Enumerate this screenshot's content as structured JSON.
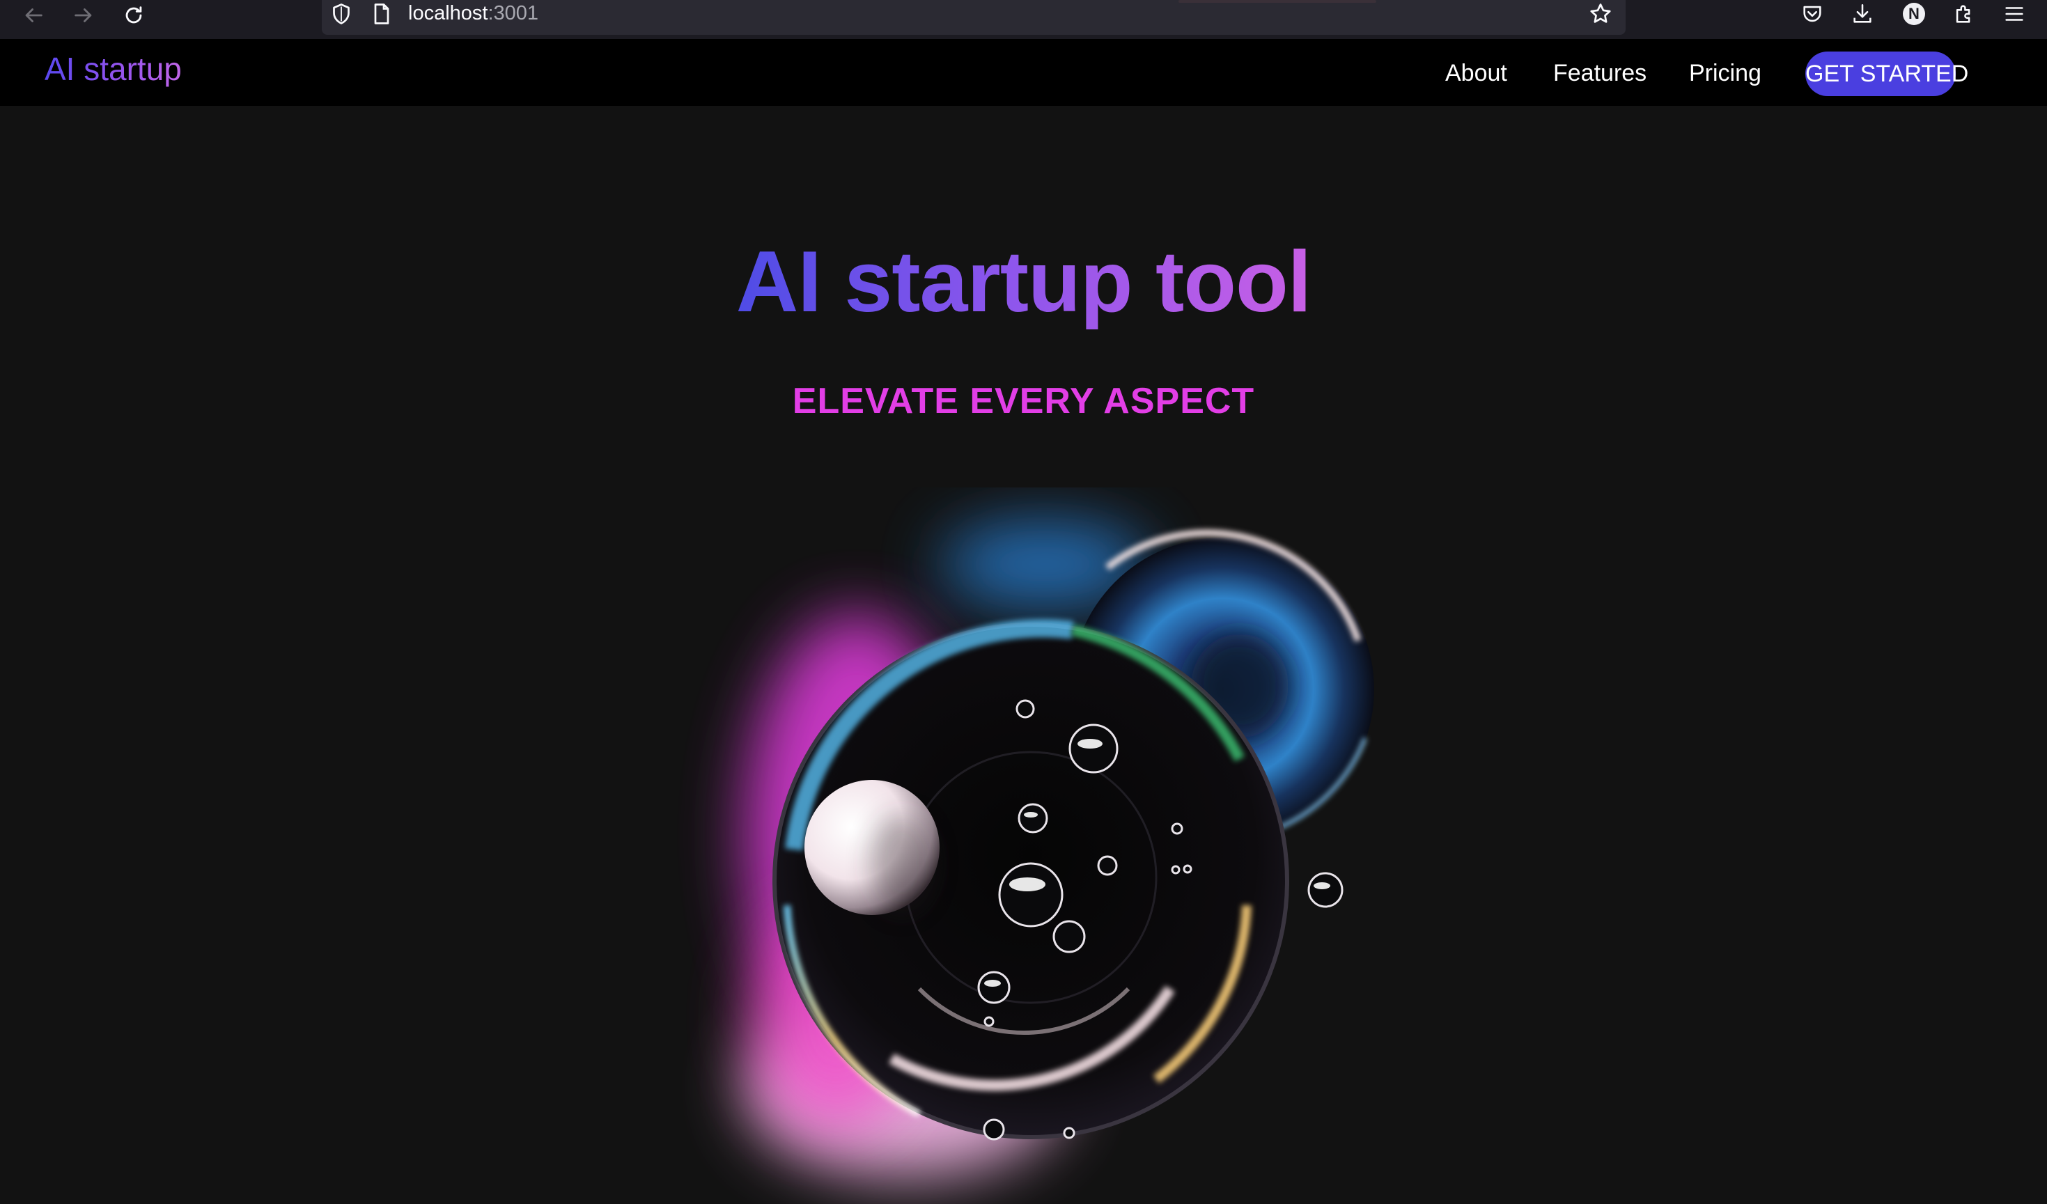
{
  "browser": {
    "url_host": "localhost",
    "url_port": ":3001",
    "profile_initial": "N",
    "icons": {
      "back": "arrow-left-icon",
      "forward": "arrow-right-icon",
      "reload": "reload-icon",
      "shield": "shield-icon",
      "page": "page-icon",
      "bookmark": "star-icon",
      "pocket": "pocket-icon",
      "downloads": "download-icon",
      "extensions": "puzzle-icon",
      "menu": "hamburger-menu-icon"
    }
  },
  "header": {
    "logo": "AI startup",
    "nav": [
      {
        "label": "About"
      },
      {
        "label": "Features"
      },
      {
        "label": "Pricing"
      }
    ],
    "cta": "GET STARTED"
  },
  "hero": {
    "title": "AI startup tool",
    "subtitle": "ELEVATE EVERY ASPECT",
    "art": "glass-bubbles-illustration"
  },
  "colors": {
    "page_bg": "#121212",
    "header_bg": "#000000",
    "cta_bg": "#4a3fe0",
    "title_gradient_start": "#4f4ce6",
    "title_gradient_end": "#c85fe6",
    "subtitle": "#e23ee6"
  }
}
